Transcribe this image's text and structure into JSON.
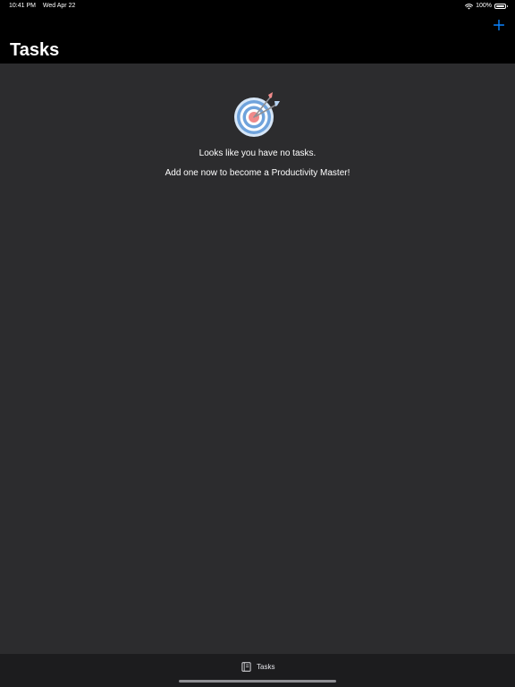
{
  "status_bar": {
    "time": "10:41 PM",
    "date": "Wed Apr 22",
    "battery_percent": "100%",
    "battery_level": 1.0
  },
  "nav": {
    "title": "Tasks",
    "add_icon": "plus-icon",
    "accent_color": "#0a84ff"
  },
  "empty_state": {
    "icon": "target-arrows-icon",
    "line1": "Looks like you have no tasks.",
    "line2": "Add one now to become a Productivity Master!"
  },
  "tab_bar": {
    "items": [
      {
        "label": "Tasks",
        "icon": "notebook-icon"
      }
    ]
  }
}
